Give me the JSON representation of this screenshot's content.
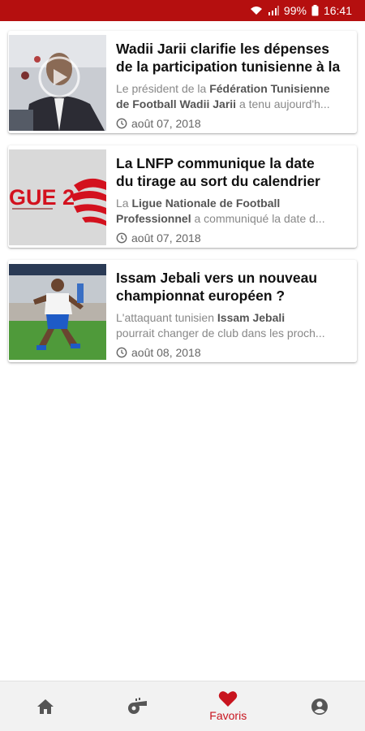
{
  "status_bar": {
    "battery": "99%",
    "time": "16:41",
    "icons": [
      "wifi-icon",
      "signal-icon",
      "battery-icon"
    ]
  },
  "feed": {
    "articles": [
      {
        "title_line1": "Wadii Jarii clarifie les dépenses",
        "title_line2": "de la participation tunisienne à la",
        "desc_plain1": "Le président de la ",
        "desc_bold1": "Fédération Tunisienne",
        "desc_bold2": "de Football Wadii Jarii",
        "desc_plain2": " a tenu aujourd'h...",
        "date": "août 07, 2018",
        "thumbnail": "press-conference-photo"
      },
      {
        "title_line1": "La LNFP communique la date",
        "title_line2": "du tirage au sort du calendrier",
        "desc_plain1": "La ",
        "desc_bold1": "Ligue Nationale de Football",
        "desc_bold2": "Professionnel",
        "desc_plain2": " a communiqué la date d...",
        "date": "août 07, 2018",
        "thumbnail": "ligue-2-logo",
        "thumb_text": "GUE 2"
      },
      {
        "title_line1": "Issam Jebali vers un nouveau",
        "title_line2": "championnat européen ?",
        "desc_plain1": "L'attaquant tunisien ",
        "desc_bold1": "Issam Jebali",
        "desc_bold2": "",
        "desc_plain2": "pourrait changer de club dans les proch...",
        "date": "août 08, 2018",
        "thumbnail": "football-player-photo"
      }
    ]
  },
  "bottom_nav": {
    "items": [
      {
        "icon": "home-icon",
        "label": ""
      },
      {
        "icon": "whistle-icon",
        "label": ""
      },
      {
        "icon": "heart-icon",
        "label": "Favoris",
        "active": true
      },
      {
        "icon": "account-icon",
        "label": ""
      }
    ]
  },
  "colors": {
    "status_bar": "#b50f0f",
    "accent": "#c8141e",
    "nav_background": "#f2f2f2"
  }
}
